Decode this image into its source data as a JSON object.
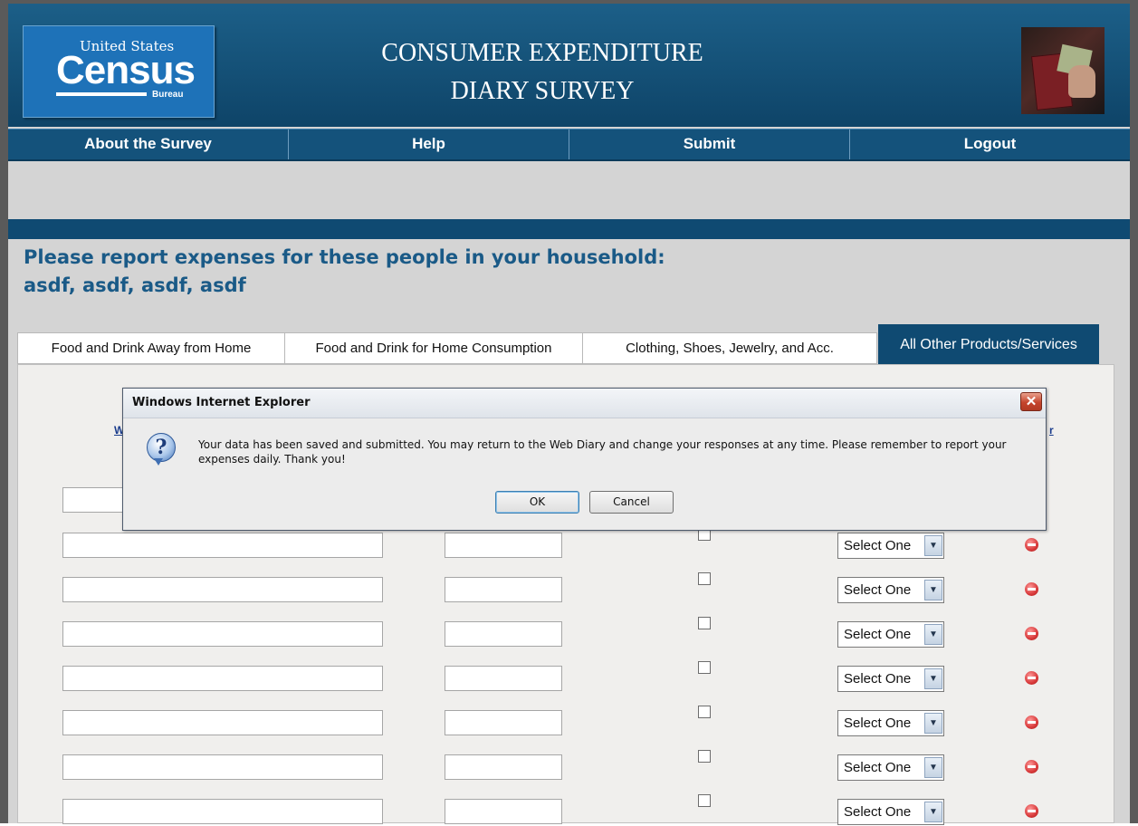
{
  "header": {
    "logo": {
      "line1": "United States",
      "line2": "Census",
      "line3": "Bureau"
    },
    "title_line1": "CONSUMER EXPENDITURE",
    "title_line2": "DIARY SURVEY"
  },
  "nav": [
    "About the Survey",
    "Help",
    "Submit",
    "Logout"
  ],
  "instructions": {
    "line1": "Please report expenses for these people in your household:",
    "line2": "asdf, asdf, asdf, asdf"
  },
  "tabs": [
    {
      "label": "Food and Drink Away from Home",
      "active": false
    },
    {
      "label": "Food and Drink for Home Consumption",
      "active": false
    },
    {
      "label": "Clothing, Shoes, Jewelry, and Acc.",
      "active": false
    },
    {
      "label": "All Other Products/Services",
      "active": true
    }
  ],
  "table": {
    "partial_link_left": "W",
    "partial_link_right": "r",
    "select_value": "Select One",
    "row_count": 7
  },
  "dialog": {
    "title": "Windows Internet Explorer",
    "message": "Your data has been saved and submitted. You may return to the Web Diary and change your responses at any time. Please remember to report your expenses daily. Thank you!",
    "ok_label": "OK",
    "cancel_label": "Cancel"
  },
  "colors": {
    "header_bg": "#0e4468",
    "nav_bg": "#14527b",
    "heading_text": "#1a5a87",
    "active_tab": "#0f4a72"
  }
}
